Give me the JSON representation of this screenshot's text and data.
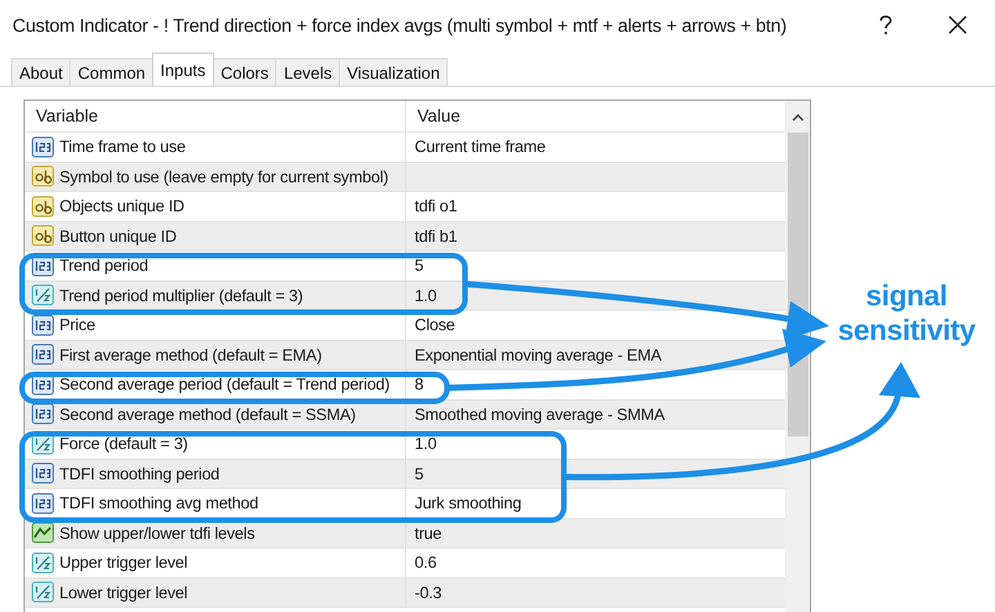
{
  "window": {
    "title": "Custom Indicator - ! Trend direction + force index avgs (multi symbol + mtf + alerts + arrows + btn)"
  },
  "tabs": [
    {
      "label": "About",
      "selected": false
    },
    {
      "label": "Common",
      "selected": false
    },
    {
      "label": "Inputs",
      "selected": true
    },
    {
      "label": "Colors",
      "selected": false
    },
    {
      "label": "Levels",
      "selected": false
    },
    {
      "label": "Visualization",
      "selected": false
    }
  ],
  "table": {
    "columns": [
      "Variable",
      "Value"
    ],
    "rows": [
      {
        "kind": "int",
        "variable": "Time frame to use",
        "value": "Current time frame",
        "highlighted": false
      },
      {
        "kind": "string",
        "variable": "Symbol to use (leave empty for current symbol)",
        "value": "",
        "highlighted": false
      },
      {
        "kind": "string",
        "variable": "Objects unique ID",
        "value": "tdfi o1",
        "highlighted": false
      },
      {
        "kind": "string",
        "variable": "Button unique ID",
        "value": "tdfi b1",
        "highlighted": false
      },
      {
        "kind": "int",
        "variable": "Trend period",
        "value": "5",
        "highlighted": true
      },
      {
        "kind": "double",
        "variable": "Trend period multiplier (default = 3)",
        "value": "1.0",
        "highlighted": true
      },
      {
        "kind": "int",
        "variable": "Price",
        "value": "Close",
        "highlighted": false
      },
      {
        "kind": "int",
        "variable": "First  average method (default = EMA)",
        "value": "Exponential moving average - EMA",
        "highlighted": false
      },
      {
        "kind": "int",
        "variable": "Second average period (default = Trend period)",
        "value": "8",
        "highlighted": true
      },
      {
        "kind": "int",
        "variable": "Second average method (default = SSMA)",
        "value": "Smoothed moving average - SMMA",
        "highlighted": false
      },
      {
        "kind": "double",
        "variable": "Force (default = 3)",
        "value": "1.0",
        "highlighted": true
      },
      {
        "kind": "int",
        "variable": "TDFI smoothing period",
        "value": "5",
        "highlighted": true
      },
      {
        "kind": "int",
        "variable": "TDFI smoothing avg method",
        "value": "Jurk smoothing",
        "highlighted": true
      },
      {
        "kind": "bool",
        "variable": "Show upper/lower  tdfi levels",
        "value": "true",
        "highlighted": false
      },
      {
        "kind": "double",
        "variable": "Upper trigger level",
        "value": "0.6",
        "highlighted": false
      },
      {
        "kind": "double",
        "variable": "Lower trigger level",
        "value": "-0.3",
        "highlighted": false
      }
    ]
  },
  "callout": {
    "label": "signal sensitivity"
  }
}
